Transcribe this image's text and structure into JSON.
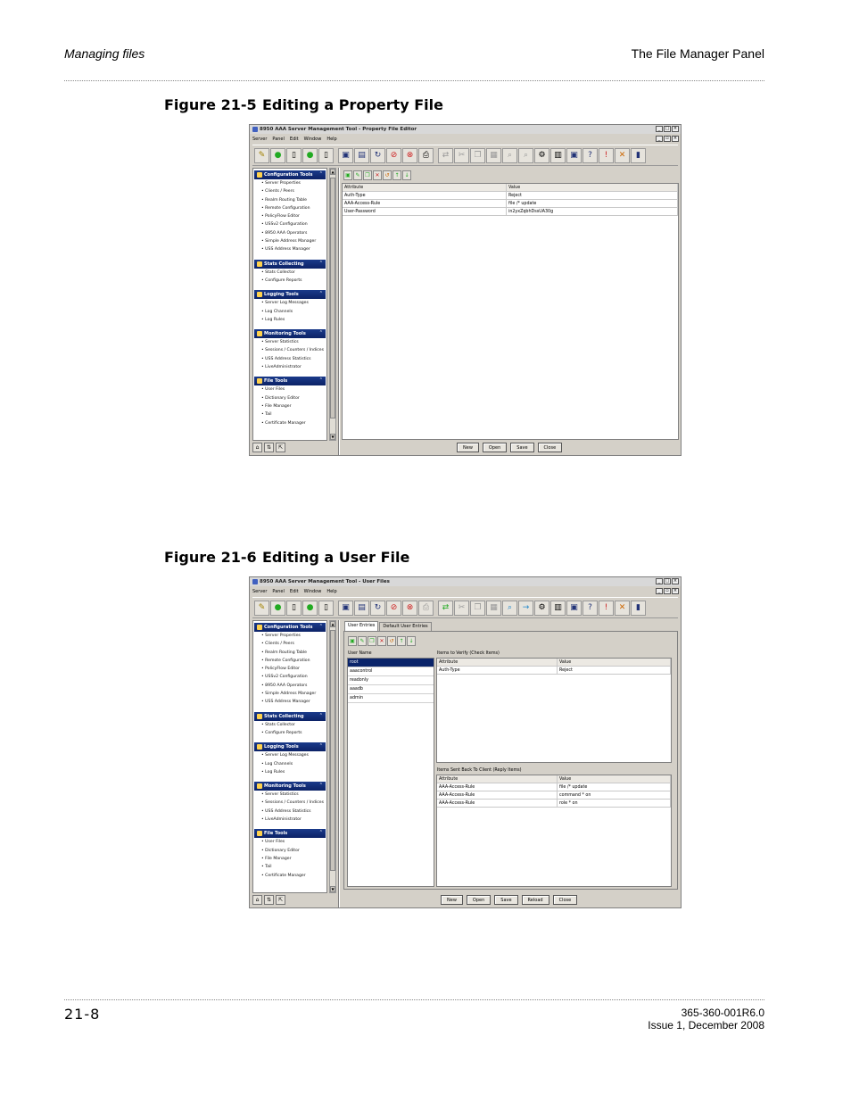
{
  "page": {
    "header_left": "Managing files",
    "header_right": "The File Manager Panel",
    "footer_left": "21-8",
    "footer_right_line1": "365-360-001R6.0",
    "footer_right_line2": "Issue 1, December 2008"
  },
  "figures": [
    {
      "number": "Figure 21-5",
      "title": "Editing a Property File",
      "window": {
        "title": "8950 AAA Server Management Tool - Property File Editor",
        "menus": [
          "Server",
          "Panel",
          "Edit",
          "Window",
          "Help"
        ],
        "table_headers": [
          "Attribute",
          "Value"
        ],
        "rows": [
          {
            "attribute": "Auth-Type",
            "value": "Reject"
          },
          {
            "attribute": "AAA-Access-Rule",
            "value": "file /* update"
          },
          {
            "attribute": "User-Password",
            "value": "in2yxZqbhDssUA30g"
          }
        ],
        "buttons": [
          "New",
          "Open",
          "Save",
          "Close"
        ]
      }
    },
    {
      "number": "Figure 21-6",
      "title": "Editing a User File",
      "window": {
        "title": "8950 AAA Server Management Tool - User Files",
        "menus": [
          "Server",
          "Panel",
          "Edit",
          "Window",
          "Help"
        ],
        "tabs": [
          "User Entries",
          "Default User Entries"
        ],
        "user_name_header": "User Name",
        "users": [
          "root",
          "aaacontrol",
          "readonly",
          "aaadb",
          "admin"
        ],
        "check_items_label": "Items to Verify (Check Items)",
        "check_headers": [
          "Attribute",
          "Value"
        ],
        "check_rows": [
          {
            "attribute": "Auth-Type",
            "value": "Reject"
          }
        ],
        "reply_items_label": "Items Sent Back To Client (Reply Items)",
        "reply_headers": [
          "Attribute",
          "Value"
        ],
        "reply_rows": [
          {
            "attribute": "AAA-Access-Rule",
            "value": "file /* update"
          },
          {
            "attribute": "AAA-Access-Rule",
            "value": "command * on"
          },
          {
            "attribute": "AAA-Access-Rule",
            "value": "role * on"
          }
        ],
        "buttons": [
          "New",
          "Open",
          "Save",
          "Reload",
          "Close"
        ]
      }
    }
  ],
  "sidebar": {
    "groups": [
      {
        "title": "Configuration Tools",
        "items": [
          "Server Properties",
          "Clients / Peers",
          "Realm Routing Table",
          "Remote Configuration",
          "PolicyFlow Editor",
          "USSv2 Configuration",
          "8950 AAA Operators",
          "Simple Address Manager",
          "USS Address Manager"
        ]
      },
      {
        "title": "Stats Collecting",
        "items": [
          "Stats Collector",
          "Configure Reports"
        ]
      },
      {
        "title": "Logging Tools",
        "items": [
          "Server Log Messages",
          "Log Channels",
          "Log Rules"
        ]
      },
      {
        "title": "Monitoring Tools",
        "items": [
          "Server Statistics",
          "Sessions / Counters / Indices",
          "USS Address Statistics",
          "LiveAdministrator"
        ]
      },
      {
        "title": "File Tools",
        "items": [
          "User Files",
          "Dictionary Editor",
          "File Manager",
          "Tail",
          "Certificate Manager"
        ]
      }
    ]
  },
  "icons": {
    "toolbar": [
      "connect-icon",
      "green-status-icon",
      "document-icon",
      "green-status-icon",
      "document-icon",
      "save-icon",
      "save-as-icon",
      "refresh-icon",
      "stop-icon",
      "print-icon",
      "sync-icon",
      "cut-icon",
      "copy-icon",
      "paste-icon",
      "find-icon",
      "find-next-icon",
      "settings-icon",
      "report-icon",
      "monitor-icon",
      "help-icon",
      "about-icon",
      "tools-icon",
      "database-icon"
    ]
  },
  "colors": {
    "group_header": "#0c2266",
    "selection": "#0a246a",
    "window_bg": "#d4d0c8"
  }
}
